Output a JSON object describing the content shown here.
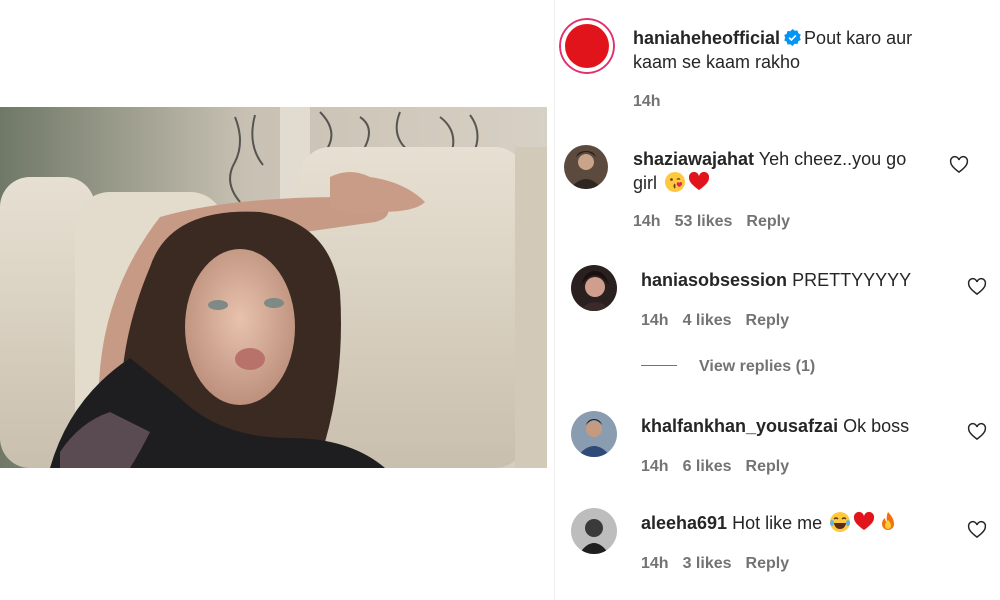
{
  "post": {
    "author": "haniaheheofficial",
    "caption_line1": "Pout karo aur",
    "caption_line2": "kaam se kaam rakho",
    "time": "14h"
  },
  "comments": [
    {
      "username": "shaziawajahat",
      "text_line1": "Yeh cheez..you go",
      "text_line2": "girl",
      "emojis": [
        "kissing-face-emoji",
        "red-heart-emoji"
      ],
      "time": "14h",
      "likes": "53 likes",
      "reply": "Reply"
    },
    {
      "username": "haniasobsession",
      "text_line1": "PRETTYYYYY",
      "time": "14h",
      "likes": "4 likes",
      "reply": "Reply",
      "view_replies": "View replies (1)"
    },
    {
      "username": "khalfankhan_yousafzai",
      "text_line1": "Ok boss",
      "time": "14h",
      "likes": "6 likes",
      "reply": "Reply"
    },
    {
      "username": "aleeha691",
      "text_line1": "Hot like me",
      "emojis": [
        "laughing-tears-emoji",
        "red-heart-emoji",
        "fire-emoji"
      ],
      "time": "14h",
      "likes": "3 likes",
      "reply": "Reply"
    }
  ],
  "colors": {
    "text": "#262626",
    "meta": "#737373",
    "verified": "#0095f6",
    "avatar_ring": "#e1306c"
  }
}
